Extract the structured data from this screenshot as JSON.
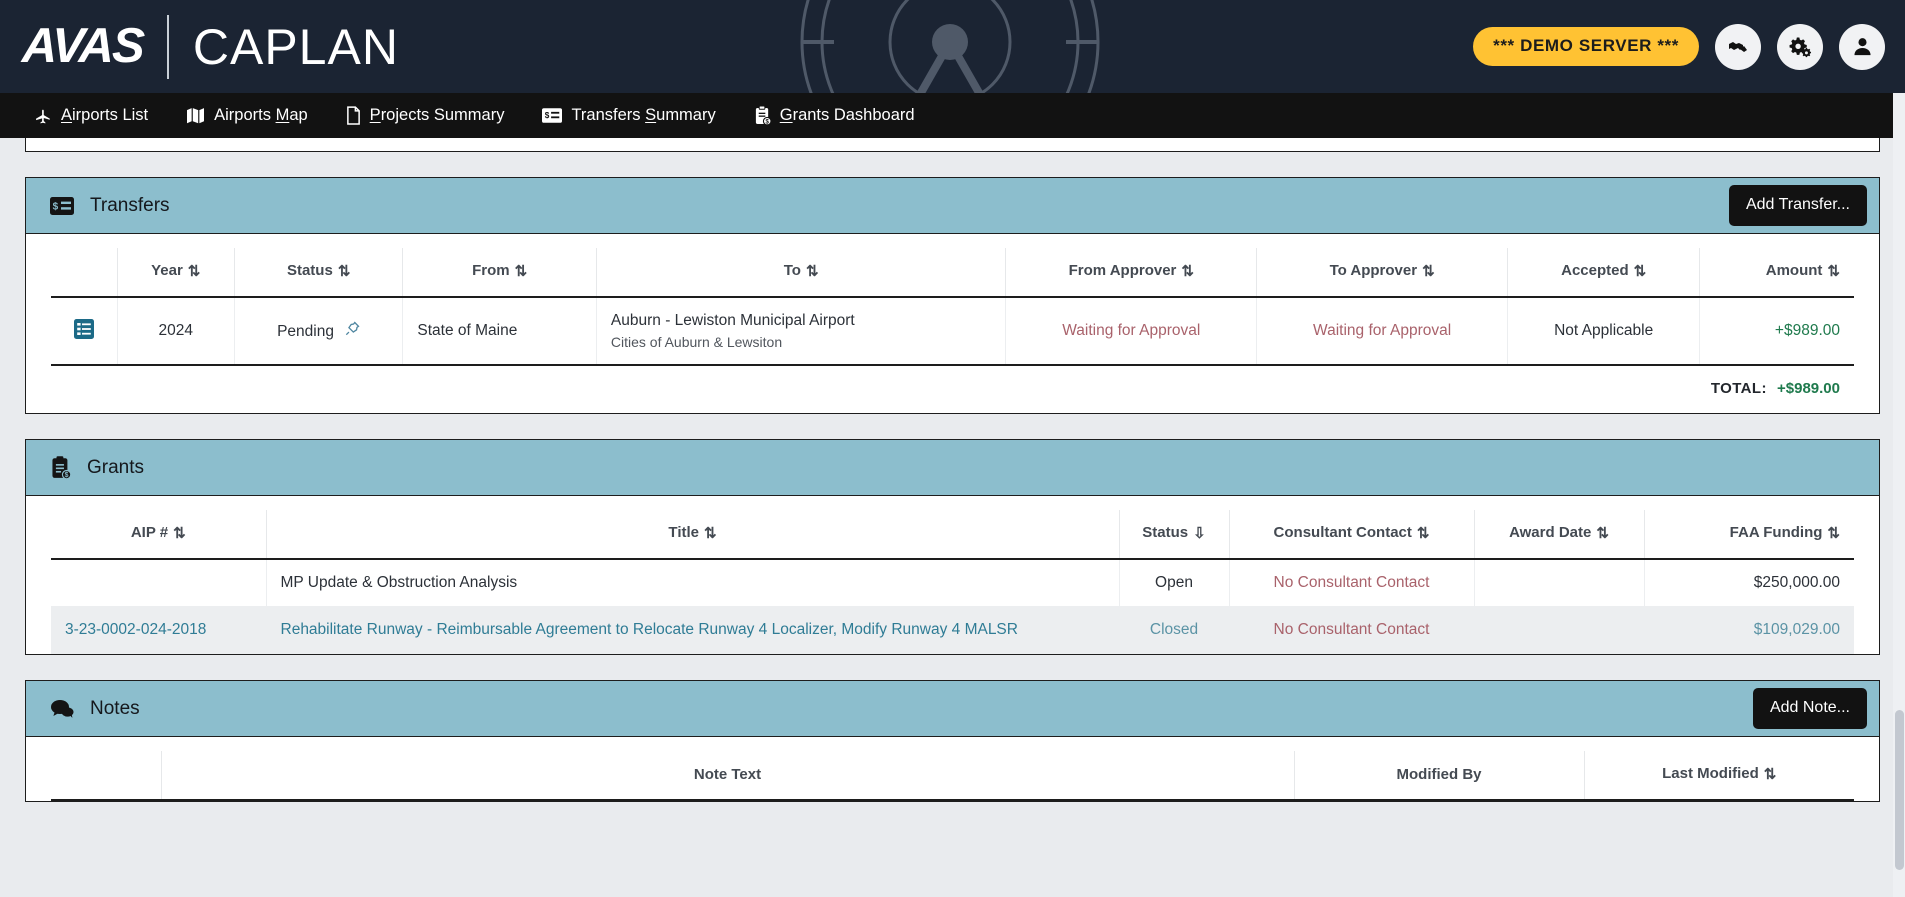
{
  "brand": {
    "mark": "AVAS",
    "name": "CAPLAN"
  },
  "header": {
    "demo_badge": "*** DEMO SERVER ***",
    "icons": [
      {
        "name": "transfers-icon",
        "label": "Transfers"
      },
      {
        "name": "settings-gears-icon",
        "label": "Settings"
      },
      {
        "name": "user-account-icon",
        "label": "Account"
      }
    ]
  },
  "nav": {
    "items": [
      {
        "icon": "airplane-icon",
        "pre": "",
        "accel": "A",
        "post": "irports List"
      },
      {
        "icon": "map-icon",
        "pre": "Airports ",
        "accel": "M",
        "post": "ap"
      },
      {
        "icon": "document-icon",
        "pre": "",
        "accel": "P",
        "post": "rojects Summary"
      },
      {
        "icon": "transfer-card-icon",
        "pre": "Transfers ",
        "accel": "S",
        "post": "ummary"
      },
      {
        "icon": "clipboard-money-icon",
        "pre": "",
        "accel": "G",
        "post": "rants Dashboard"
      }
    ]
  },
  "transfers": {
    "title": "Transfers",
    "add_button": "Add Transfer...",
    "columns": [
      "",
      "Year",
      "Status",
      "From",
      "To",
      "From Approver",
      "To Approver",
      "Accepted",
      "Amount"
    ],
    "rows": [
      {
        "year": "2024",
        "status": "Pending",
        "from": "State of Maine",
        "to_primary": "Auburn - Lewiston Municipal Airport",
        "to_secondary": "Cities of Auburn & Lewsiton",
        "from_approver": "Waiting for Approval",
        "to_approver": "Waiting for Approval",
        "accepted": "Not Applicable",
        "amount": "+$989.00"
      }
    ],
    "total_label": "TOTAL:",
    "total_value": "+$989.00"
  },
  "grants": {
    "title": "Grants",
    "columns": [
      "AIP #",
      "Title",
      "Status",
      "Consultant Contact",
      "Award Date",
      "FAA Funding"
    ],
    "rows": [
      {
        "aip": "",
        "title": "MP Update & Obstruction Analysis",
        "status": "Open",
        "consultant": "No Consultant Contact",
        "award_date": "",
        "faa_funding": "$250,000.00"
      },
      {
        "aip": "3-23-0002-024-2018",
        "title": "Rehabilitate Runway - Reimbursable Agreement to Relocate Runway 4 Localizer, Modify Runway 4 MALSR",
        "status": "Closed",
        "consultant": "No Consultant Contact",
        "award_date": "",
        "faa_funding": "$109,029.00"
      }
    ]
  },
  "notes": {
    "title": "Notes",
    "add_button": "Add Note...",
    "columns": [
      "",
      "Note Text",
      "Modified By",
      "Last Modified"
    ]
  },
  "colors": {
    "header_bg": "#1b2433",
    "nav_bg": "#121212",
    "card_head_bg": "#8cbecd",
    "accent_yellow": "#ffc233",
    "money_green": "#1f7a4d",
    "warn_red": "#a9626b",
    "link_teal": "#2f7c95",
    "page_bg": "#e9ebee"
  }
}
